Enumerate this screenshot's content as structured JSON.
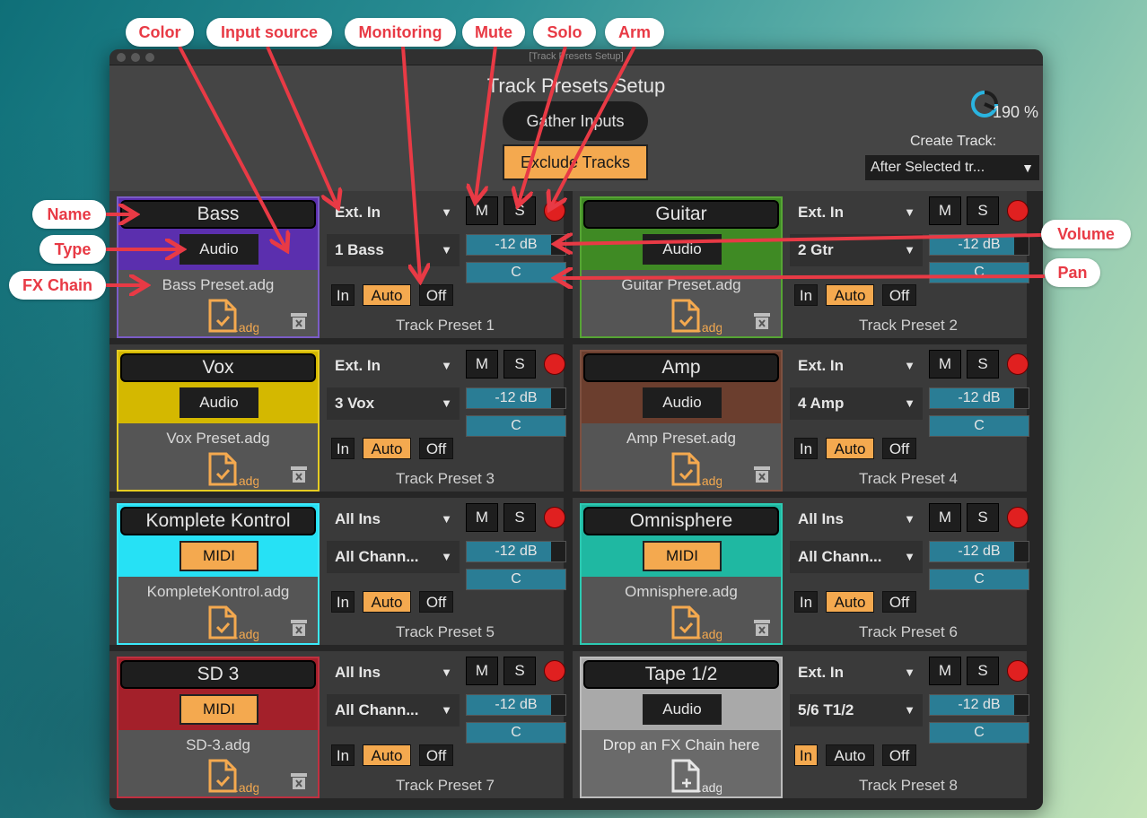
{
  "window_title": "[Track Presets Setup]",
  "header": {
    "title": "Track Presets Setup",
    "zoom": "190 %",
    "gather_label": "Gather Inputs",
    "exclude_label": "Exclude Tracks",
    "create_track_label": "Create Track:",
    "create_track_value": "After Selected tr..."
  },
  "monitor_labels": {
    "in": "In",
    "auto": "Auto",
    "off": "Off"
  },
  "button_labels": {
    "mute": "M",
    "solo": "S"
  },
  "tracks": [
    {
      "name": "Bass",
      "type": "Audio",
      "color": "#5b2fae",
      "border": "#7b5cc7",
      "fx_chain": "Bass Preset.adg",
      "has_chain": true,
      "input_source": "Ext. In",
      "input_channel": "1 Bass",
      "volume": "-12 dB",
      "volume_level": 0.85,
      "pan": "C",
      "monitoring": "Auto",
      "preset_label": "Track Preset 1"
    },
    {
      "name": "Guitar",
      "type": "Audio",
      "color": "#3f8a24",
      "border": "#56a534",
      "fx_chain": "Guitar Preset.adg",
      "has_chain": true,
      "input_source": "Ext. In",
      "input_channel": "2 Gtr",
      "volume": "-12 dB",
      "volume_level": 0.85,
      "pan": "C",
      "monitoring": "Auto",
      "preset_label": "Track Preset 2"
    },
    {
      "name": "Vox",
      "type": "Audio",
      "color": "#d4b800",
      "border": "#e6cc22",
      "fx_chain": "Vox Preset.adg",
      "has_chain": true,
      "input_source": "Ext. In",
      "input_channel": "3 Vox",
      "volume": "-12 dB",
      "volume_level": 0.85,
      "pan": "C",
      "monitoring": "Auto",
      "preset_label": "Track Preset 3"
    },
    {
      "name": "Amp",
      "type": "Audio",
      "color": "#6b3e2e",
      "border": "#7d5040",
      "fx_chain": "Amp Preset.adg",
      "has_chain": true,
      "input_source": "Ext. In",
      "input_channel": "4 Amp",
      "volume": "-12 dB",
      "volume_level": 0.85,
      "pan": "C",
      "monitoring": "Auto",
      "preset_label": "Track Preset 4"
    },
    {
      "name": "Komplete Kontrol",
      "type": "MIDI",
      "color": "#26e1f5",
      "border": "#3be9fb",
      "fx_chain": "KompleteKontrol.adg",
      "has_chain": true,
      "input_source": "All Ins",
      "input_channel": "All Chann...",
      "volume": "-12 dB",
      "volume_level": 0.85,
      "pan": "C",
      "monitoring": "Auto",
      "preset_label": "Track Preset 5"
    },
    {
      "name": "Omnisphere",
      "type": "MIDI",
      "color": "#1fb8a2",
      "border": "#2ccab2",
      "fx_chain": "Omnisphere.adg",
      "has_chain": true,
      "input_source": "All Ins",
      "input_channel": "All Chann...",
      "volume": "-12 dB",
      "volume_level": 0.85,
      "pan": "C",
      "monitoring": "Auto",
      "preset_label": "Track Preset 6"
    },
    {
      "name": "SD 3",
      "type": "MIDI",
      "color": "#a3202a",
      "border": "#c03040",
      "fx_chain": "SD-3.adg",
      "has_chain": true,
      "input_source": "All Ins",
      "input_channel": "All Chann...",
      "volume": "-12 dB",
      "volume_level": 0.85,
      "pan": "C",
      "monitoring": "Auto",
      "preset_label": "Track Preset 7"
    },
    {
      "name": "Tape 1/2",
      "type": "Audio",
      "color": "#a9a9a9",
      "border": "#bcbcbc",
      "fx_chain": "Drop an FX Chain here",
      "has_chain": false,
      "input_source": "Ext. In",
      "input_channel": "5/6 T1/2",
      "volume": "-12 dB",
      "volume_level": 0.85,
      "pan": "C",
      "monitoring": "In",
      "preset_label": "Track Preset 8"
    }
  ],
  "file_icon_ext": ".adg",
  "callouts": {
    "color": "Color",
    "input_source": "Input source",
    "monitoring": "Monitoring",
    "mute": "Mute",
    "solo": "Solo",
    "arm": "Arm",
    "name": "Name",
    "type": "Type",
    "fx_chain": "FX Chain",
    "volume": "Volume",
    "pan": "Pan"
  },
  "colors": {
    "accent": "#f4a94f",
    "callout_text": "#e83a45",
    "arrow": "#e83a45",
    "meter": "#2a7d95",
    "arm": "#e02020"
  }
}
